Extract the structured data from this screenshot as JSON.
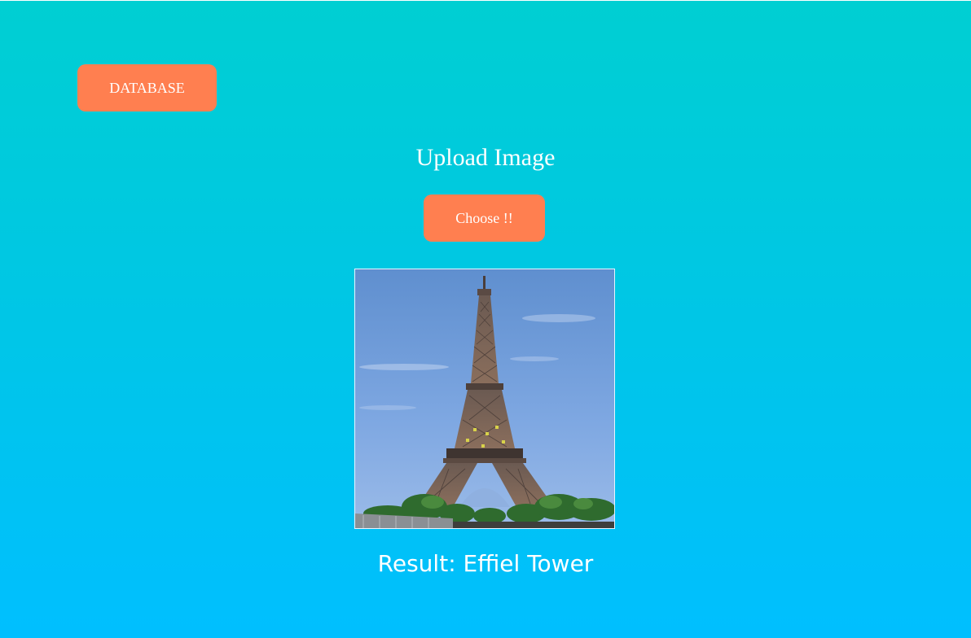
{
  "database_button": {
    "label": "DATABASE"
  },
  "upload": {
    "title": "Upload Image",
    "choose_label": "Choose !!"
  },
  "preview": {
    "subject_icon": "eiffel-tower-photo"
  },
  "result": {
    "text": "Result: Effiel Tower"
  },
  "colors": {
    "background_top": "#00cfd2",
    "background_bottom": "#00bfff",
    "button": "#ff7f50",
    "text": "#ffffff"
  }
}
